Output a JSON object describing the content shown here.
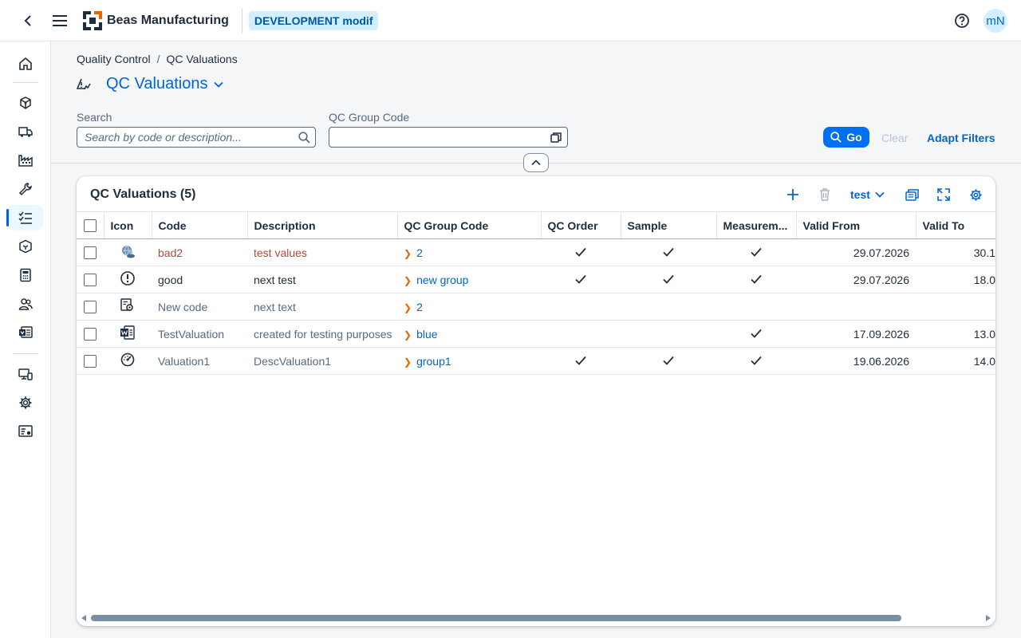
{
  "shell": {
    "app_name": "Beas Manufacturing",
    "environment": "DEVELOPMENT modif",
    "user_initials": "mN"
  },
  "breadcrumb": [
    "Quality Control",
    "QC Valuations"
  ],
  "page": {
    "title": "QC Valuations"
  },
  "filters": {
    "search_label": "Search",
    "search_placeholder": "Search by code or description...",
    "search_value": "",
    "group_label": "QC Group Code",
    "group_value": "",
    "go_label": "Go",
    "clear_label": "Clear",
    "adapt_label": "Adapt Filters"
  },
  "table": {
    "title": "QC Valuations (5)",
    "variant": "test",
    "columns": [
      "Icon",
      "Code",
      "Description",
      "QC Group Code",
      "QC Order",
      "Sample",
      "Measurem...",
      "Valid From",
      "Valid To"
    ],
    "rows": [
      {
        "icon": "globe-person-icon",
        "code": "bad2",
        "description": "test values",
        "group": "2",
        "qc_order": true,
        "sample": true,
        "measurement": true,
        "valid_from": "29.07.2026",
        "valid_to": "30.1",
        "style": "red"
      },
      {
        "icon": "exclamation-circle-icon",
        "code": "good",
        "description": "next test",
        "group": "new group",
        "qc_order": true,
        "sample": true,
        "measurement": true,
        "valid_from": "29.07.2026",
        "valid_to": "18.0",
        "style": "normal"
      },
      {
        "icon": "inspection-icon",
        "code": "New code",
        "description": "next text",
        "group": "2",
        "qc_order": false,
        "sample": false,
        "measurement": false,
        "valid_from": "",
        "valid_to": "",
        "style": "grey"
      },
      {
        "icon": "word-document-icon",
        "code": "TestValuation",
        "description": "created for testing purposes",
        "group": "blue",
        "qc_order": false,
        "sample": false,
        "measurement": true,
        "valid_from": "17.09.2026",
        "valid_to": "13.0",
        "style": "grey"
      },
      {
        "icon": "dashboard-gauge-icon",
        "code": "Valuation1",
        "description": "DescValuation1",
        "group": "group1",
        "qc_order": true,
        "sample": true,
        "measurement": true,
        "valid_from": "19.06.2026",
        "valid_to": "14.0",
        "style": "grey"
      }
    ]
  },
  "colors": {
    "accent": "#0064d9",
    "brand_orange": "#e76500",
    "button": "#0070f2"
  },
  "sidenav": [
    "home-icon",
    "cubes-icon",
    "truck-icon",
    "factory-icon",
    "wrench-icon",
    "checklist-icon",
    "box-icon",
    "calculator-icon",
    "people-icon",
    "document-icon",
    "monitor-icon",
    "gear-icon",
    "settings-list-icon"
  ]
}
